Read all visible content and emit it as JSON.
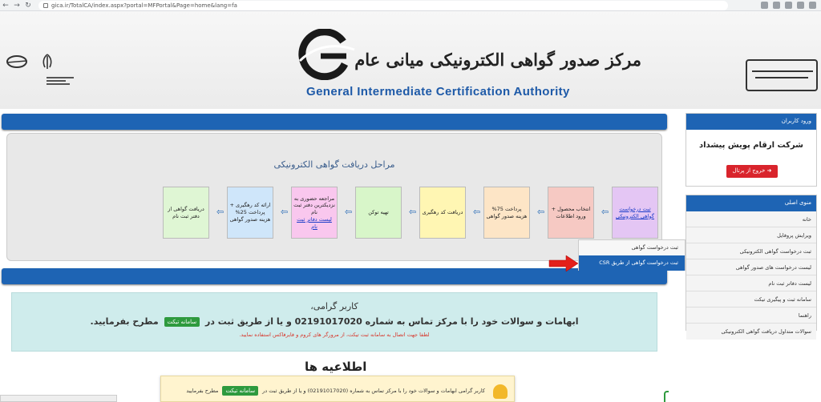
{
  "browser": {
    "url": "gica.ir/TotalCA/index.aspx?portal=MFPortal&Page=home&lang=fa"
  },
  "header": {
    "title_fa": "مرکز صدور گواهی الکترونیکی میانی عام",
    "title_en": "General Intermediate Certification Authority"
  },
  "steps": {
    "title": "مراحل دریافت گواهی الکترونیکی",
    "items": [
      {
        "text": "ثبت درخواست گواهی الکترونیکی",
        "bg": "#e4c6f4",
        "link": true
      },
      {
        "text": "انتخاب محصول + ورود اطلاعات",
        "bg": "#f6c9c3",
        "link": false
      },
      {
        "text": "پرداخت 75% هزینه صدور گواهی",
        "bg": "#fde5c6",
        "link": false
      },
      {
        "text": "دریافت کد رهگیری",
        "bg": "#fff6b3",
        "link": false
      },
      {
        "text": "تهیه توکن",
        "bg": "#d8f6c9",
        "link": false
      },
      {
        "text": "مراجعه حضوری به نزدیکترین دفتر ثبت نام",
        "sub": "لیست دفاتر ثبت نام",
        "bg": "#f9c7ee",
        "link": false
      },
      {
        "text": "ارائه کد رهگیری + پرداخت 25% هزینه صدور گواهی",
        "bg": "#cfe6fa",
        "link": false
      },
      {
        "text": "دریافت گواهی از دفتر ثبت نام",
        "bg": "#dff6d4",
        "link": false
      }
    ]
  },
  "sidebar": {
    "login_title": "ورود کاربران",
    "company": "شرکت ارقام پویش پیشداد",
    "logout": "خروج از پرتال",
    "menu_title": "منوی اصلی",
    "menu": [
      "خانه",
      "ویرایش پروفایل",
      "ثبت درخواست گواهی الکترونیکی",
      "لیست درخواست های صدور گواهی",
      "لیست دفاتر ثبت نام",
      "سامانه ثبت و پیگیری تیکت",
      "راهنما",
      "سوالات متداول دریافت گواهی الکترونیکی"
    ]
  },
  "dropdown": {
    "items": [
      "ثبت درخواست گواهی",
      "ثبت درخواست گواهی از طریق CSR"
    ]
  },
  "contact": {
    "greeting": "کاربر گرامی،",
    "line1a": "ابهامات و سوالات خود را با مرکز تماس به شماره 02191017020 و یا از طریق ثبت در",
    "ticket_btn": "سامانه تیکت",
    "line1b": "مطرح بفرمایید.",
    "note": "لطفا جهت اتصال به سامانه ثبت تیکت، از مرورگر های کروم و فایرفاکس استفاده نمایید."
  },
  "news": {
    "title": "اطلاعیه ها"
  },
  "notification": {
    "text_a": "کاربر گرامی ابهامات و سوالات خود را با مرکز تماس به شماره (02191017020) و یا از طریق ثبت در",
    "ticket_btn": "سامانه تیکت",
    "text_b": "مطرح بفرمایید"
  },
  "colors": {
    "primary": "#1e64b4",
    "logout": "#d9242c",
    "ticket": "#2e9a3e"
  }
}
